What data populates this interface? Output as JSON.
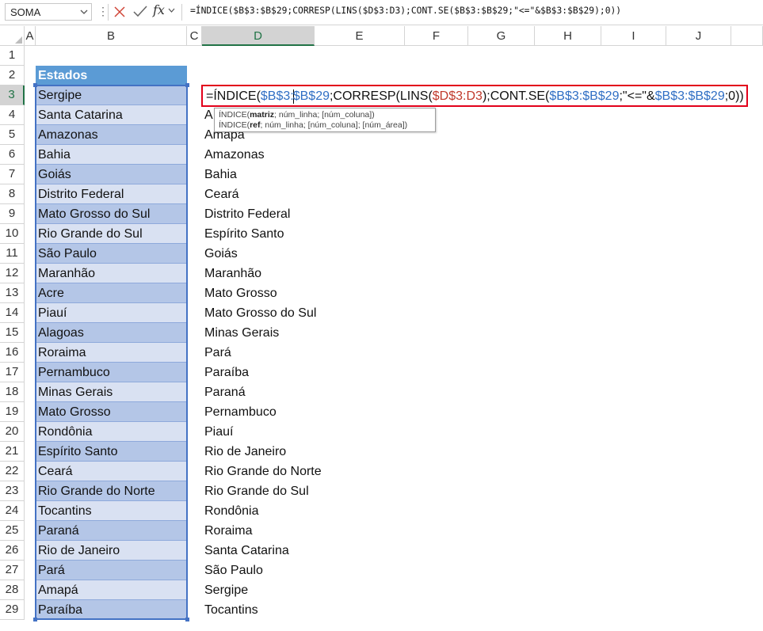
{
  "formula_bar": {
    "name_box": "SOMA",
    "cancel_icon": "close-icon",
    "enter_icon": "check-icon",
    "fx_label": "fx",
    "formula": "=ÍNDICE($B$3:$B$29;CORRESP(LINS($D$3:D3);CONT.SE($B$3:$B$29;\"<=\"&$B$3:$B$29);0))"
  },
  "columns": [
    "A",
    "B",
    "C",
    "D",
    "E",
    "F",
    "G",
    "H",
    "I",
    "J"
  ],
  "active_column": "D",
  "rows": [
    "1",
    "2",
    "3",
    "4",
    "5",
    "6",
    "7",
    "8",
    "9",
    "10",
    "11",
    "12",
    "13",
    "14",
    "15",
    "16",
    "17",
    "18",
    "19",
    "20",
    "21",
    "22",
    "23",
    "24",
    "25",
    "26",
    "27",
    "28",
    "29"
  ],
  "active_row": "3",
  "table": {
    "header": "Estados",
    "colors": {
      "header": "#5b9bd5",
      "odd_row": "#b4c6e7",
      "even_row": "#d9e1f2",
      "border": "#8ea9db"
    },
    "values": [
      "Sergipe",
      "Santa Catarina",
      "Amazonas",
      "Bahia",
      "Goiás",
      "Distrito Federal",
      "Mato Grosso do Sul",
      "Rio Grande do Sul",
      "São Paulo",
      "Maranhão",
      "Acre",
      "Piauí",
      "Alagoas",
      "Roraima",
      "Pernambuco",
      "Minas Gerais",
      "Mato Grosso",
      "Rondônia",
      "Espírito Santo",
      "Ceará",
      "Rio Grande do Norte",
      "Tocantins",
      "Paraná",
      "Rio de Janeiro",
      "Pará",
      "Amapá",
      "Paraíba"
    ]
  },
  "sorted_column": {
    "row4_partial": "A",
    "values": [
      "Amapá",
      "Amazonas",
      "Bahia",
      "Ceará",
      "Distrito Federal",
      "Espírito Santo",
      "Goiás",
      "Maranhão",
      "Mato Grosso",
      "Mato Grosso do Sul",
      "Minas Gerais",
      "Pará",
      "Paraíba",
      "Paraná",
      "Pernambuco",
      "Piauí",
      "Rio de Janeiro",
      "Rio Grande do Norte",
      "Rio Grande do Sul",
      "Rondônia",
      "Roraima",
      "Santa Catarina",
      "São Paulo",
      "Sergipe",
      "Tocantins"
    ]
  },
  "edit_cell": {
    "parts": [
      "=ÍNDICE(",
      "$B$3:",
      "$B$29",
      ";CORRESP(LINS(",
      "$D$3:D3",
      ");CONT.SE(",
      "$B$3:$B$29",
      ";\"<=\"&",
      "$B$3:$B$29",
      ";0))"
    ],
    "border_color": "#e2001a"
  },
  "tooltip": {
    "line1_fn": "ÍNDICE(",
    "line1_arg": "matriz",
    "line1_rest": "; núm_linha; [núm_coluna])",
    "line2_fn": "ÍNDICE(",
    "line2_arg": "ref",
    "line2_rest": "; núm_linha; [núm_coluna]; [núm_área])"
  }
}
